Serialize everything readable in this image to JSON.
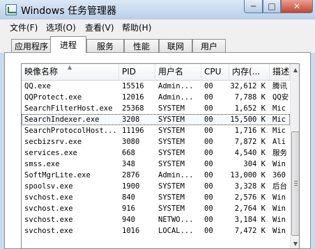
{
  "window": {
    "title": "Windows 任务管理器",
    "min_glyph": "─",
    "max_glyph": "□",
    "close_glyph": "✕"
  },
  "menu": [
    {
      "label": "文件(F)"
    },
    {
      "label": "选项(O)"
    },
    {
      "label": "查看(V)"
    },
    {
      "label": "帮助(H)"
    }
  ],
  "tabs": [
    {
      "label": "应用程序"
    },
    {
      "label": "进程",
      "active": true
    },
    {
      "label": "服务"
    },
    {
      "label": "性能"
    },
    {
      "label": "联网"
    },
    {
      "label": "用户"
    }
  ],
  "columns": {
    "name": "映像名称",
    "pid": "PID",
    "user": "用户名",
    "cpu": "CPU",
    "mem": "内存(...",
    "desc": "描述"
  },
  "sort_indicator": "▲",
  "processes": [
    {
      "name": "QQ.exe",
      "pid": "15516",
      "user": "Admin...",
      "cpu": "00",
      "mem": "32,612 K",
      "desc": "腾讯"
    },
    {
      "name": "QQProtect.exe",
      "pid": "12016",
      "user": "Admin...",
      "cpu": "00",
      "mem": "7,788 K",
      "desc": "QQ安"
    },
    {
      "name": "SearchFilterHost.exe",
      "pid": "25368",
      "user": "SYSTEM",
      "cpu": "00",
      "mem": "1,652 K",
      "desc": "Mic"
    },
    {
      "name": "SearchIndexer.exe",
      "pid": "3208",
      "user": "SYSTEM",
      "cpu": "00",
      "mem": "15,500 K",
      "desc": "Mic",
      "selected": true
    },
    {
      "name": "SearchProtocolHost...",
      "pid": "11196",
      "user": "SYSTEM",
      "cpu": "00",
      "mem": "1,716 K",
      "desc": "Mic"
    },
    {
      "name": "secbizsrv.exe",
      "pid": "3080",
      "user": "SYSTEM",
      "cpu": "00",
      "mem": "7,872 K",
      "desc": "Ali"
    },
    {
      "name": "services.exe",
      "pid": "668",
      "user": "SYSTEM",
      "cpu": "00",
      "mem": "4,540 K",
      "desc": "服务"
    },
    {
      "name": "smss.exe",
      "pid": "348",
      "user": "SYSTEM",
      "cpu": "00",
      "mem": "304 K",
      "desc": "Win"
    },
    {
      "name": "SoftMgrLite.exe",
      "pid": "2876",
      "user": "Admin...",
      "cpu": "00",
      "mem": "13,000 K",
      "desc": "360"
    },
    {
      "name": "spoolsv.exe",
      "pid": "1900",
      "user": "SYSTEM",
      "cpu": "00",
      "mem": "3,328 K",
      "desc": "后台"
    },
    {
      "name": "svchost.exe",
      "pid": "840",
      "user": "SYSTEM",
      "cpu": "00",
      "mem": "2,576 K",
      "desc": "Win"
    },
    {
      "name": "svchost.exe",
      "pid": "916",
      "user": "SYSTEM",
      "cpu": "00",
      "mem": "2,764 K",
      "desc": "Win"
    },
    {
      "name": "svchost.exe",
      "pid": "940",
      "user": "NETWO...",
      "cpu": "00",
      "mem": "3,184 K",
      "desc": "Win"
    },
    {
      "name": "svchost.exe",
      "pid": "1016",
      "user": "LOCAL...",
      "cpu": "00",
      "mem": "7,472 K",
      "desc": "Win"
    }
  ],
  "scrollbar": {
    "up_glyph": "▲",
    "down_glyph": "▼"
  },
  "colors": {
    "window_frame": "#c9dbee",
    "close_button": "#c7432c"
  }
}
